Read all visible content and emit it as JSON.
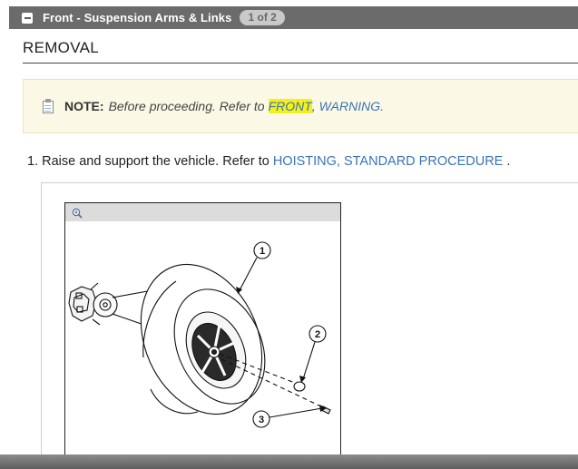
{
  "header": {
    "title": "Front - Suspension Arms & Links",
    "page_indicator": "1 of 2"
  },
  "section": {
    "title": "REMOVAL"
  },
  "note": {
    "label": "NOTE:",
    "text": "Before proceeding. Refer to",
    "link_front": "FRONT",
    "separator": ",",
    "link_warning": "WARNING."
  },
  "steps": [
    {
      "number": "1.",
      "text": "Raise and support the vehicle. Refer to",
      "link": "HOISTING, STANDARD PROCEDURE",
      "suffix": "."
    }
  ],
  "figure": {
    "callouts": [
      "1",
      "2",
      "3"
    ],
    "zoom_icon": "zoom-in-icon"
  },
  "colors": {
    "header_bg": "#6b6b6b",
    "link": "#3b74b5",
    "highlight": "#f6f01a",
    "note_bg": "#fbf8e6"
  }
}
